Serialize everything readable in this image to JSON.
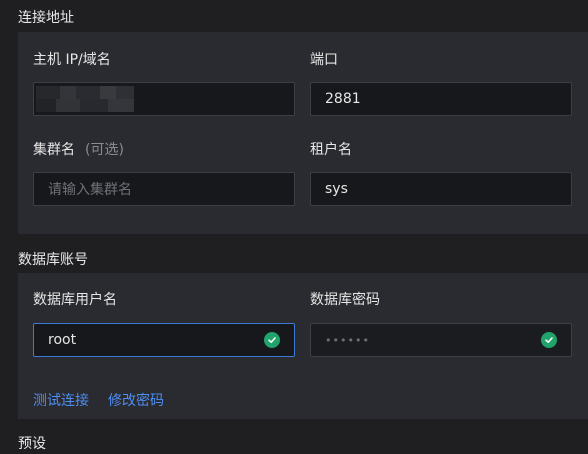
{
  "sections": {
    "connection": {
      "title": "连接地址",
      "host": {
        "label": "主机 IP/域名",
        "value": ""
      },
      "port": {
        "label": "端口",
        "value": "2881"
      },
      "cluster": {
        "label": "集群名",
        "optional": "(可选)",
        "placeholder": "请输入集群名"
      },
      "tenant": {
        "label": "租户名",
        "value": "sys"
      }
    },
    "account": {
      "title": "数据库账号",
      "username": {
        "label": "数据库用户名",
        "value": "root"
      },
      "password": {
        "label": "数据库密码",
        "masked": "••••••"
      },
      "actions": {
        "test": "测试连接",
        "change_password": "修改密码"
      }
    },
    "next": {
      "title_partial": "预设"
    }
  },
  "colors": {
    "accent": "#4d8ef0",
    "success": "#21a46b",
    "background": "#1f1f22",
    "card": "#2a2b30",
    "input": "#17181b"
  },
  "icons": {
    "valid": "check-circle-icon"
  }
}
